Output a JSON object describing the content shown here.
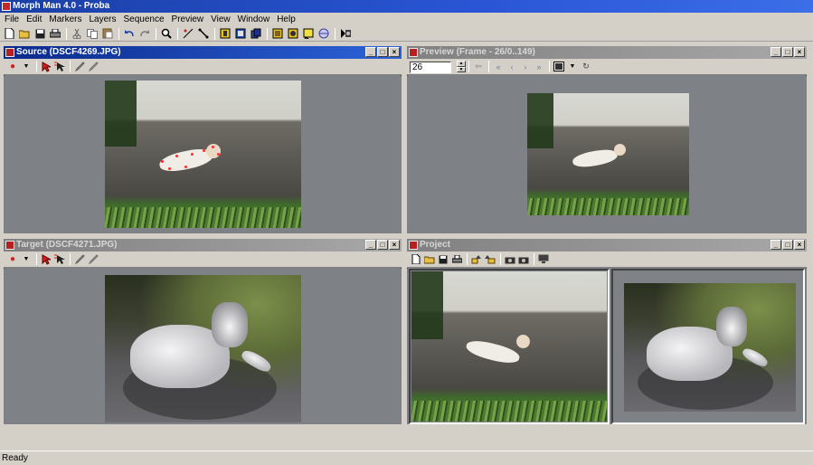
{
  "app": {
    "title": "Morph Man 4.0 - Proba"
  },
  "menu": [
    "File",
    "Edit",
    "Markers",
    "Layers",
    "Sequence",
    "Preview",
    "View",
    "Window",
    "Help"
  ],
  "toolbar_icons": [
    "new-icon",
    "open-icon",
    "save-icon",
    "print-icon",
    "cut-icon",
    "copy-icon",
    "paste-icon",
    "undo-icon",
    "redo-icon",
    "zoom-icon",
    "edit-lines-icon",
    "link-icon",
    "layer1-icon",
    "layer2-icon",
    "layer3-icon",
    "layer4-icon",
    "layer5-icon",
    "layer6-icon",
    "layer7-icon",
    "render-icon"
  ],
  "windows": {
    "source": {
      "title": "Source (DSCF4269.JPG)"
    },
    "preview": {
      "title": "Preview (Frame - 26/0..149)",
      "frame_value": "26"
    },
    "target": {
      "title": "Target (DSCF4271.JPG)"
    },
    "project": {
      "title": "Project"
    }
  },
  "window_buttons": {
    "minimize": "_",
    "maximize": "□",
    "close": "×"
  },
  "status": {
    "text": "Ready"
  }
}
